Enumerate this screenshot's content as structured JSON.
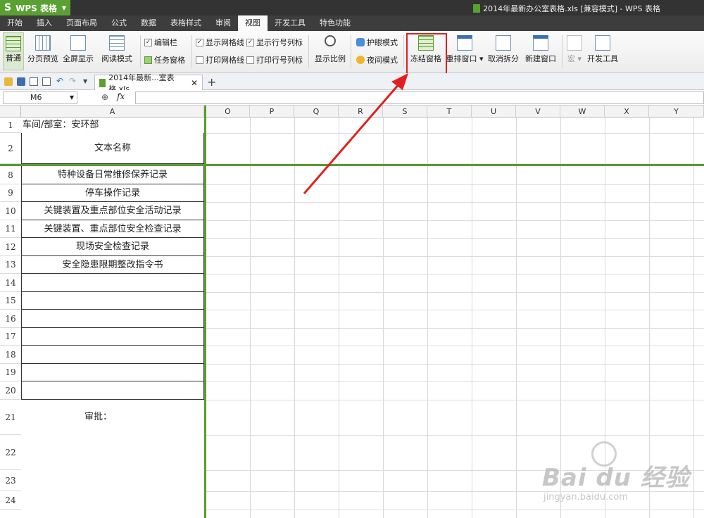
{
  "app": {
    "name": "WPS 表格",
    "window_title": "2014年最新办公室表格.xls [兼容模式] - WPS 表格"
  },
  "menu": [
    "开始",
    "插入",
    "页面布局",
    "公式",
    "数据",
    "表格样式",
    "审阅",
    "视图",
    "开发工具",
    "特色功能"
  ],
  "active_menu": "视图",
  "ribbon": {
    "normal": "普通",
    "page_break": "分页预览",
    "fullscreen": "全屏显示",
    "reading": "阅读模式",
    "edit_bar": "编辑栏",
    "task_pane": "任务窗格",
    "show_grid": "显示网格线",
    "show_headers": "显示行号列标",
    "print_grid": "打印网格线",
    "print_headers": "打印行号列标",
    "zoom": "显示比例",
    "eye_mode": "护眼模式",
    "night_mode": "夜间模式",
    "freeze": "冻结窗格",
    "arrange": "重排窗口",
    "unsplit": "取消拆分",
    "new_window": "新建窗口",
    "macro": "宏",
    "dev_tools": "开发工具"
  },
  "checkbox_states": {
    "edit_bar": true,
    "task_pane": true,
    "show_grid": true,
    "show_headers": true,
    "print_grid": false,
    "print_headers": false
  },
  "file_tab": "2014年最新...室表格.xls",
  "name_box": "M6",
  "fx_label": "fx",
  "columns": [
    "A",
    "O",
    "P",
    "Q",
    "R",
    "S",
    "T",
    "U",
    "V",
    "W",
    "X",
    "Y"
  ],
  "rows": [
    {
      "num": "1",
      "text": ""
    },
    {
      "num": "2",
      "text": "文本名称"
    },
    {
      "num": "8",
      "text": "特种设备日常维修保养记录"
    },
    {
      "num": "9",
      "text": "停车操作记录"
    },
    {
      "num": "10",
      "text": "关键装置及重点部位安全活动记录"
    },
    {
      "num": "11",
      "text": "关键装置、重点部位安全检查记录"
    },
    {
      "num": "12",
      "text": "现场安全检查记录"
    },
    {
      "num": "13",
      "text": "安全隐患限期整改指令书"
    },
    {
      "num": "14",
      "text": ""
    },
    {
      "num": "15",
      "text": ""
    },
    {
      "num": "16",
      "text": ""
    },
    {
      "num": "17",
      "text": ""
    },
    {
      "num": "18",
      "text": ""
    },
    {
      "num": "19",
      "text": ""
    },
    {
      "num": "20",
      "text": ""
    },
    {
      "num": "21",
      "text": "审批："
    },
    {
      "num": "22",
      "text": ""
    },
    {
      "num": "23",
      "text": ""
    },
    {
      "num": "24",
      "text": ""
    }
  ],
  "row1_text": "车间/部室：安环部",
  "watermark": {
    "main": "Bai du 经验",
    "sub": "jingyan.baidu.com"
  },
  "colors": {
    "brand_green": "#5aa032",
    "highlight_red": "#e02020",
    "freeze_line": "#5a9a2e"
  }
}
